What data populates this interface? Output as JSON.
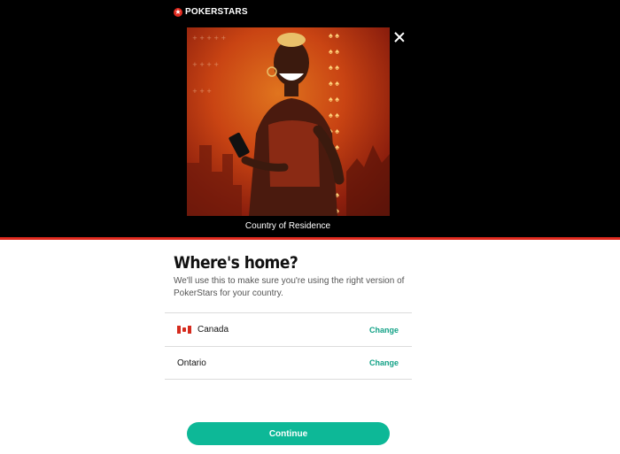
{
  "brand": {
    "name": "POKERSTARS",
    "accent": "#e02a1f",
    "cta_color": "#0db897",
    "link_color": "#12a186"
  },
  "hero": {
    "caption": "Country of Residence"
  },
  "modal": {
    "title": "Where's home?",
    "description": "We'll use this to make sure you're using the right version of PokerStars for your country."
  },
  "selections": {
    "country": {
      "label": "Canada",
      "flag": "canada-flag-icon",
      "action": "Change"
    },
    "province": {
      "label": "Ontario",
      "action": "Change"
    }
  },
  "actions": {
    "continue_label": "Continue"
  }
}
